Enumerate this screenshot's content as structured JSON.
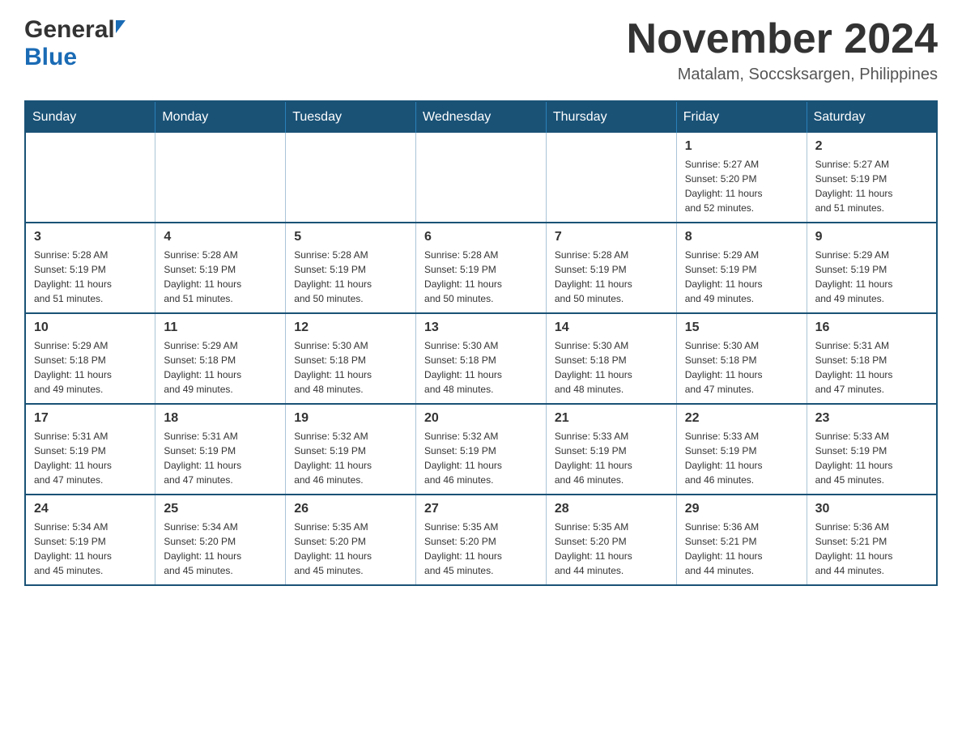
{
  "logo": {
    "general": "General",
    "flag": "",
    "blue": "Blue"
  },
  "title": {
    "month_year": "November 2024",
    "location": "Matalam, Soccsksargen, Philippines"
  },
  "calendar": {
    "headers": [
      "Sunday",
      "Monday",
      "Tuesday",
      "Wednesday",
      "Thursday",
      "Friday",
      "Saturday"
    ],
    "rows": [
      [
        {
          "day": "",
          "info": ""
        },
        {
          "day": "",
          "info": ""
        },
        {
          "day": "",
          "info": ""
        },
        {
          "day": "",
          "info": ""
        },
        {
          "day": "",
          "info": ""
        },
        {
          "day": "1",
          "info": "Sunrise: 5:27 AM\nSunset: 5:20 PM\nDaylight: 11 hours\nand 52 minutes."
        },
        {
          "day": "2",
          "info": "Sunrise: 5:27 AM\nSunset: 5:19 PM\nDaylight: 11 hours\nand 51 minutes."
        }
      ],
      [
        {
          "day": "3",
          "info": "Sunrise: 5:28 AM\nSunset: 5:19 PM\nDaylight: 11 hours\nand 51 minutes."
        },
        {
          "day": "4",
          "info": "Sunrise: 5:28 AM\nSunset: 5:19 PM\nDaylight: 11 hours\nand 51 minutes."
        },
        {
          "day": "5",
          "info": "Sunrise: 5:28 AM\nSunset: 5:19 PM\nDaylight: 11 hours\nand 50 minutes."
        },
        {
          "day": "6",
          "info": "Sunrise: 5:28 AM\nSunset: 5:19 PM\nDaylight: 11 hours\nand 50 minutes."
        },
        {
          "day": "7",
          "info": "Sunrise: 5:28 AM\nSunset: 5:19 PM\nDaylight: 11 hours\nand 50 minutes."
        },
        {
          "day": "8",
          "info": "Sunrise: 5:29 AM\nSunset: 5:19 PM\nDaylight: 11 hours\nand 49 minutes."
        },
        {
          "day": "9",
          "info": "Sunrise: 5:29 AM\nSunset: 5:19 PM\nDaylight: 11 hours\nand 49 minutes."
        }
      ],
      [
        {
          "day": "10",
          "info": "Sunrise: 5:29 AM\nSunset: 5:18 PM\nDaylight: 11 hours\nand 49 minutes."
        },
        {
          "day": "11",
          "info": "Sunrise: 5:29 AM\nSunset: 5:18 PM\nDaylight: 11 hours\nand 49 minutes."
        },
        {
          "day": "12",
          "info": "Sunrise: 5:30 AM\nSunset: 5:18 PM\nDaylight: 11 hours\nand 48 minutes."
        },
        {
          "day": "13",
          "info": "Sunrise: 5:30 AM\nSunset: 5:18 PM\nDaylight: 11 hours\nand 48 minutes."
        },
        {
          "day": "14",
          "info": "Sunrise: 5:30 AM\nSunset: 5:18 PM\nDaylight: 11 hours\nand 48 minutes."
        },
        {
          "day": "15",
          "info": "Sunrise: 5:30 AM\nSunset: 5:18 PM\nDaylight: 11 hours\nand 47 minutes."
        },
        {
          "day": "16",
          "info": "Sunrise: 5:31 AM\nSunset: 5:18 PM\nDaylight: 11 hours\nand 47 minutes."
        }
      ],
      [
        {
          "day": "17",
          "info": "Sunrise: 5:31 AM\nSunset: 5:19 PM\nDaylight: 11 hours\nand 47 minutes."
        },
        {
          "day": "18",
          "info": "Sunrise: 5:31 AM\nSunset: 5:19 PM\nDaylight: 11 hours\nand 47 minutes."
        },
        {
          "day": "19",
          "info": "Sunrise: 5:32 AM\nSunset: 5:19 PM\nDaylight: 11 hours\nand 46 minutes."
        },
        {
          "day": "20",
          "info": "Sunrise: 5:32 AM\nSunset: 5:19 PM\nDaylight: 11 hours\nand 46 minutes."
        },
        {
          "day": "21",
          "info": "Sunrise: 5:33 AM\nSunset: 5:19 PM\nDaylight: 11 hours\nand 46 minutes."
        },
        {
          "day": "22",
          "info": "Sunrise: 5:33 AM\nSunset: 5:19 PM\nDaylight: 11 hours\nand 46 minutes."
        },
        {
          "day": "23",
          "info": "Sunrise: 5:33 AM\nSunset: 5:19 PM\nDaylight: 11 hours\nand 45 minutes."
        }
      ],
      [
        {
          "day": "24",
          "info": "Sunrise: 5:34 AM\nSunset: 5:19 PM\nDaylight: 11 hours\nand 45 minutes."
        },
        {
          "day": "25",
          "info": "Sunrise: 5:34 AM\nSunset: 5:20 PM\nDaylight: 11 hours\nand 45 minutes."
        },
        {
          "day": "26",
          "info": "Sunrise: 5:35 AM\nSunset: 5:20 PM\nDaylight: 11 hours\nand 45 minutes."
        },
        {
          "day": "27",
          "info": "Sunrise: 5:35 AM\nSunset: 5:20 PM\nDaylight: 11 hours\nand 45 minutes."
        },
        {
          "day": "28",
          "info": "Sunrise: 5:35 AM\nSunset: 5:20 PM\nDaylight: 11 hours\nand 44 minutes."
        },
        {
          "day": "29",
          "info": "Sunrise: 5:36 AM\nSunset: 5:21 PM\nDaylight: 11 hours\nand 44 minutes."
        },
        {
          "day": "30",
          "info": "Sunrise: 5:36 AM\nSunset: 5:21 PM\nDaylight: 11 hours\nand 44 minutes."
        }
      ]
    ]
  }
}
